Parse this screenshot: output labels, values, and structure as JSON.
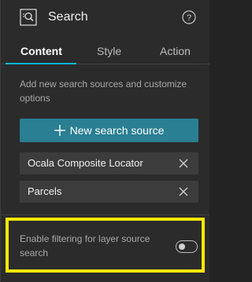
{
  "header": {
    "title": "Search",
    "widget_icon": "search-widget-icon",
    "help_icon": "help-icon"
  },
  "tabs": [
    {
      "label": "Content",
      "active": true
    },
    {
      "label": "Style",
      "active": false
    },
    {
      "label": "Action",
      "active": false
    }
  ],
  "content": {
    "description": "Add new search sources and customize options",
    "new_source_label": "New search source",
    "sources": [
      {
        "label": "Ocala Composite Locator",
        "remove_icon": "close-icon"
      },
      {
        "label": "Parcels",
        "remove_icon": "close-icon"
      }
    ],
    "filter_setting": {
      "label": "Enable filtering for layer source search",
      "enabled": false
    }
  },
  "colors": {
    "background": "#2b2b2b",
    "accent": "#00b8d4",
    "button": "#2a7f93",
    "highlight": "#ffe800"
  }
}
